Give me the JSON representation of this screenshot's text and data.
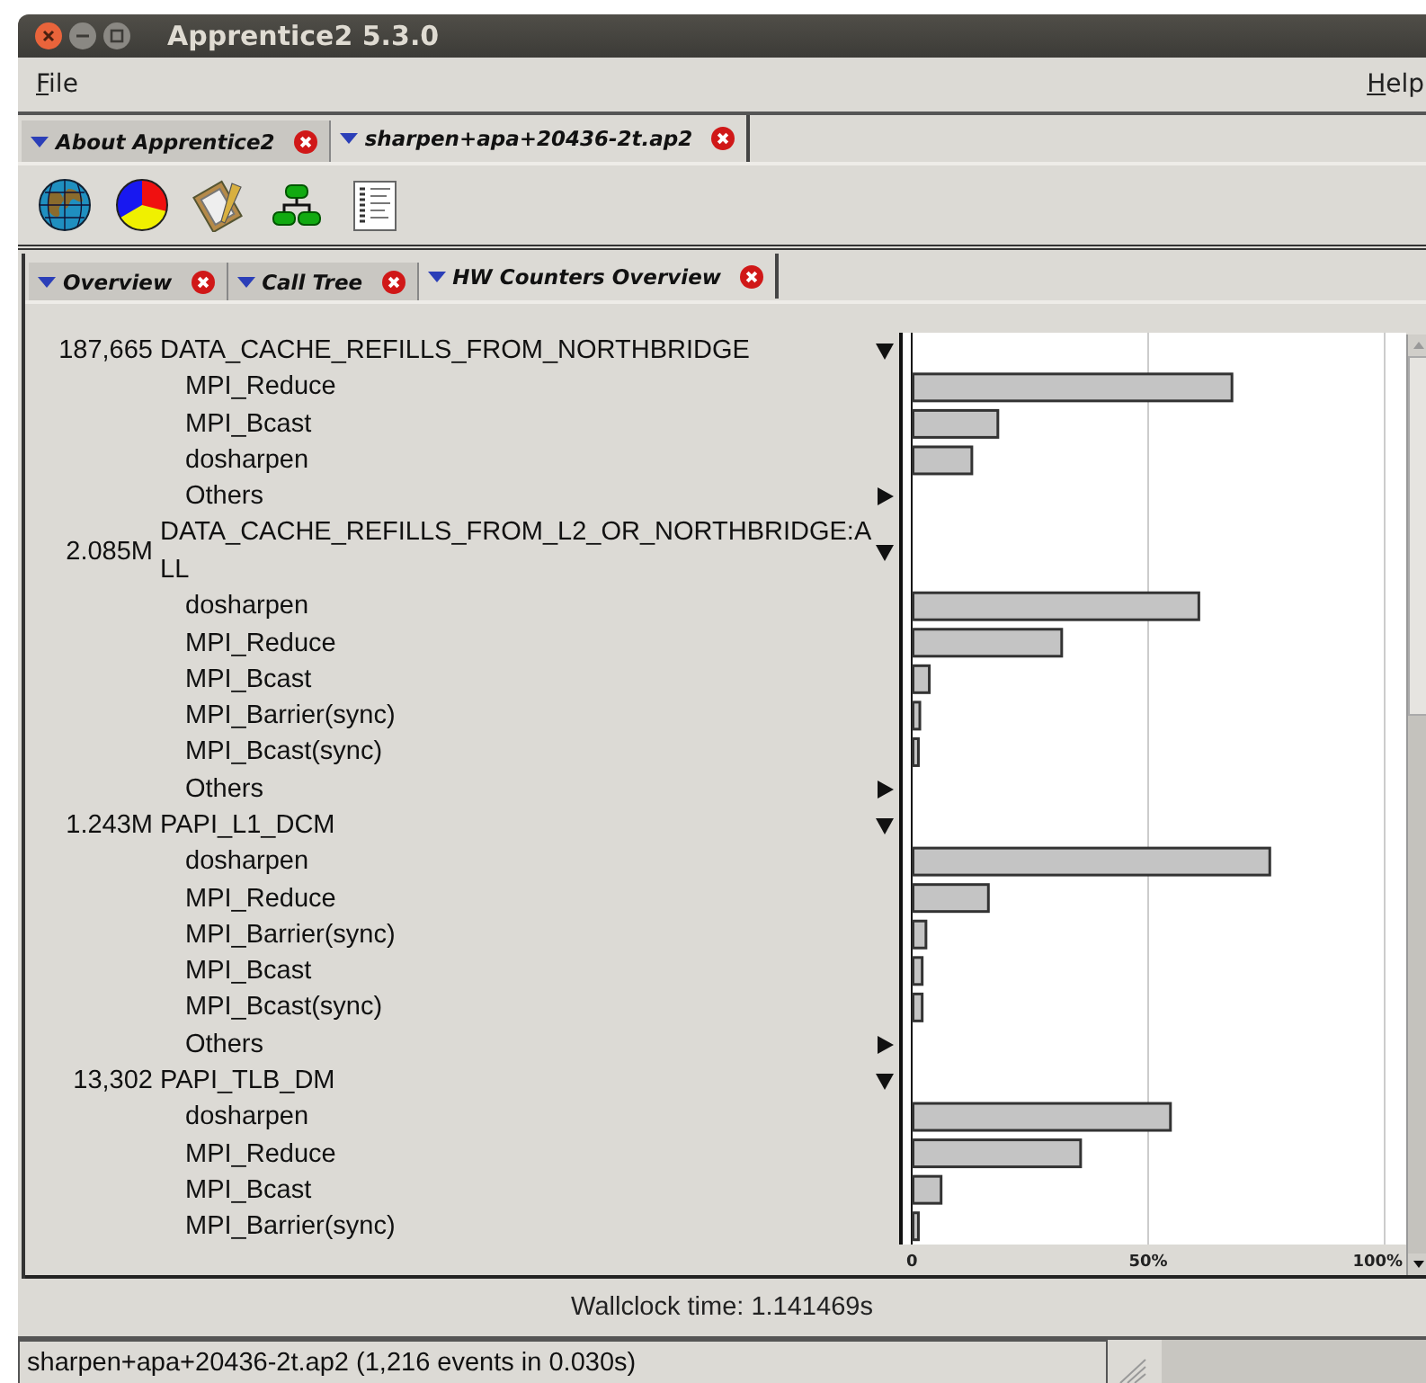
{
  "window": {
    "title": "Apprentice2 5.3.0"
  },
  "menu": [
    {
      "label": "File"
    },
    {
      "label": "Help"
    }
  ],
  "file_tabs": [
    {
      "label": "About Apprentice2",
      "selected": false
    },
    {
      "label": "sharpen+apa+20436-2t.ap2",
      "selected": true
    }
  ],
  "view_tabs": [
    {
      "label": "Overview",
      "selected": false
    },
    {
      "label": "Call Tree",
      "selected": false
    },
    {
      "label": "HW Counters Overview",
      "selected": true
    }
  ],
  "counters": [
    {
      "value": "187,665",
      "name": "DATA_CACHE_REFILLS_FROM_NORTHBRIDGE",
      "expanded": true,
      "functions": [
        "MPI_Reduce",
        "MPI_Bcast",
        "dosharpen"
      ],
      "others": {
        "label": "Others",
        "expanded": false
      }
    },
    {
      "value": "2.085M",
      "name": "DATA_CACHE_REFILLS_FROM_L2_OR_NORTHBRIDGE:ALL",
      "expanded": true,
      "functions": [
        "dosharpen",
        "MPI_Reduce",
        "MPI_Bcast",
        "MPI_Barrier(sync)",
        "MPI_Bcast(sync)"
      ],
      "others": {
        "label": "Others",
        "expanded": false
      }
    },
    {
      "value": "1.243M",
      "name": "PAPI_L1_DCM",
      "expanded": true,
      "functions": [
        "dosharpen",
        "MPI_Reduce",
        "MPI_Barrier(sync)",
        "MPI_Bcast",
        "MPI_Bcast(sync)"
      ],
      "others": {
        "label": "Others",
        "expanded": false
      }
    },
    {
      "value": "13,302",
      "name": "PAPI_TLB_DM",
      "expanded": true,
      "functions": [
        "dosharpen",
        "MPI_Reduce",
        "MPI_Bcast",
        "MPI_Barrier(sync)"
      ]
    }
  ],
  "chart_data": {
    "type": "bar",
    "orientation": "horizontal",
    "xlim": [
      0,
      100
    ],
    "xticks": [
      {
        "value": 0,
        "label": "0"
      },
      {
        "value": 50,
        "label": "50%"
      },
      {
        "value": 100,
        "label": "100%"
      }
    ],
    "values": [
      null,
      68,
      18.5,
      13,
      null,
      null,
      null,
      61,
      32,
      4,
      2,
      1.7,
      null,
      null,
      76,
      16.5,
      3.3,
      2.5,
      2.5,
      null,
      null,
      55,
      36,
      6.5,
      1.7
    ]
  },
  "wallclock": "Wallclock time: 1.141469s",
  "status": "sharpen+apa+20436-2t.ap2 (1,216 events in 0.030s)"
}
